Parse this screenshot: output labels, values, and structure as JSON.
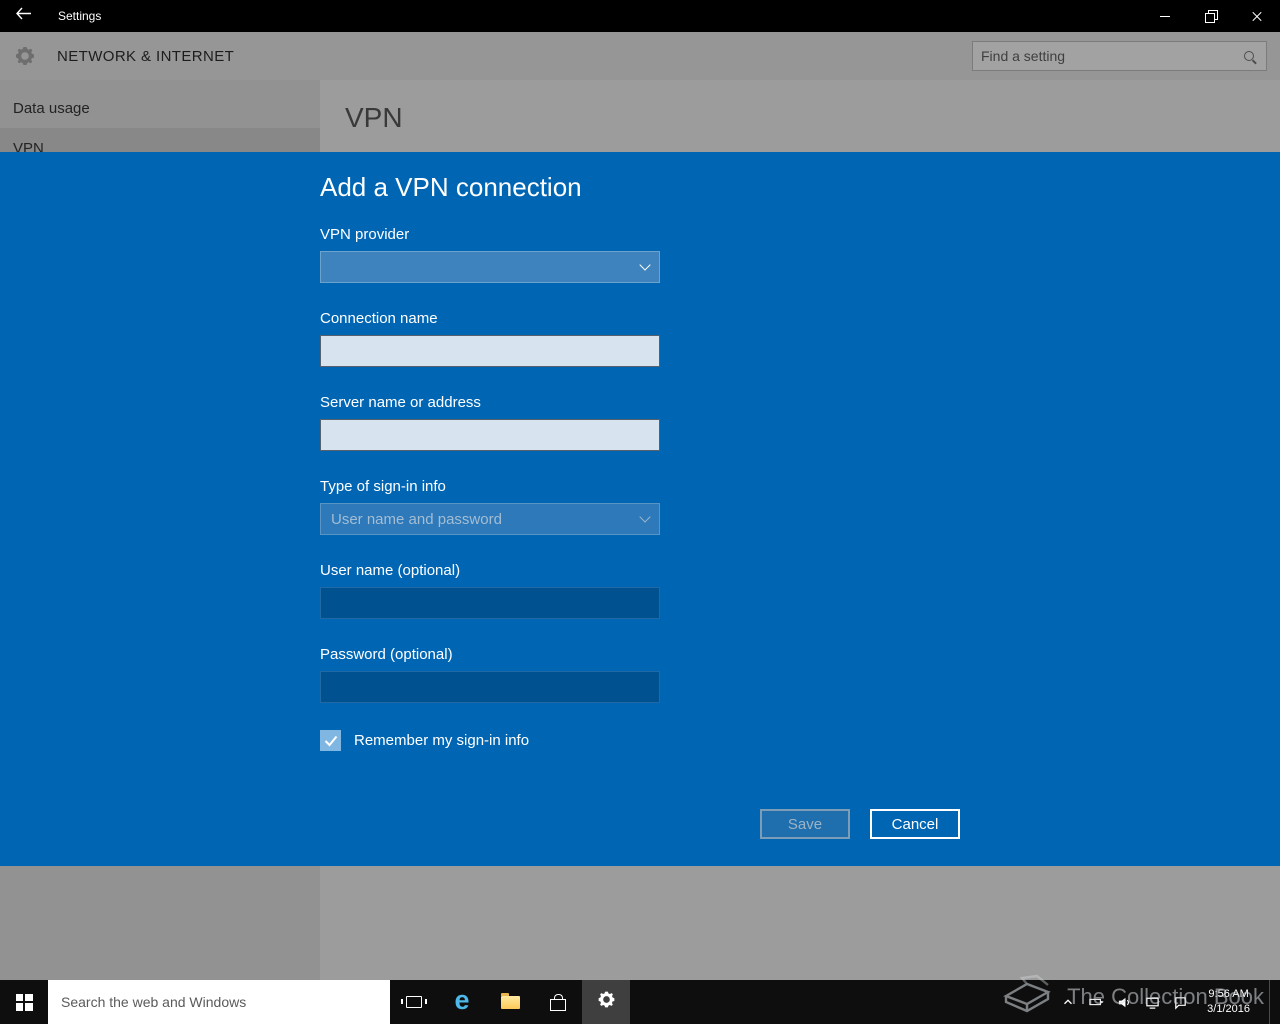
{
  "titlebar": {
    "title": "Settings"
  },
  "header": {
    "title": "NETWORK & INTERNET",
    "search_placeholder": "Find a setting"
  },
  "sidebar": {
    "items": [
      {
        "label": "Data usage"
      },
      {
        "label": "VPN"
      }
    ]
  },
  "page": {
    "title": "VPN"
  },
  "dialog": {
    "title": "Add a VPN connection",
    "vpn_provider_label": "VPN provider",
    "vpn_provider_value": "",
    "connection_name_label": "Connection name",
    "connection_name_value": "",
    "server_label": "Server name or address",
    "server_value": "",
    "signin_type_label": "Type of sign-in info",
    "signin_type_value": "User name and password",
    "username_label": "User name (optional)",
    "username_value": "",
    "password_label": "Password (optional)",
    "password_value": "",
    "remember_label": "Remember my sign-in info",
    "remember_checked": true,
    "save_label": "Save",
    "cancel_label": "Cancel"
  },
  "taskbar": {
    "search_placeholder": "Search the web and Windows",
    "time": "9:56 AM",
    "date": "3/1/2016"
  },
  "watermark": {
    "text": "The Collection Book"
  },
  "icons": {
    "edge_glyph": "e"
  },
  "colors": {
    "accent": "#0066b4",
    "titlebar": "#000000",
    "taskbar": "#0e0e0e",
    "dim_gray": "#9a9a9a"
  }
}
